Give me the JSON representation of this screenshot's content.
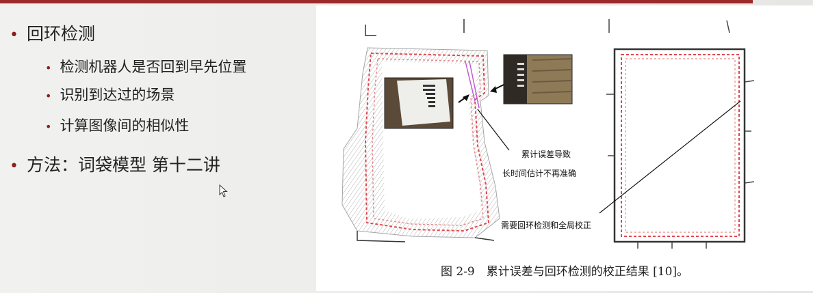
{
  "slide": {
    "bullets": {
      "loop_closure": "回环检测",
      "detect_return": "检测机器人是否回到早先位置",
      "recognize_scene": "识别到达过的场景",
      "compute_similarity": "计算图像间的相似性",
      "method": "方法：词袋模型 第十二讲"
    },
    "figure": {
      "caption": "图 2-9　累计误差与回环检测的校正结果 [10]。",
      "annotation_drift_line1": "累计误差导致",
      "annotation_drift_line2": "长时间估计不再准确",
      "annotation_correction": "需要回环检测和全局校正"
    }
  },
  "colors": {
    "accent_bar": "#9b2a2a",
    "bullet_dot": "#8b1d1d",
    "trajectory": "#e0474f"
  }
}
